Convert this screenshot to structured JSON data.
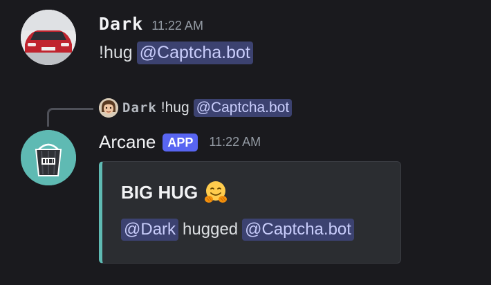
{
  "messages": [
    {
      "author": "Dark",
      "timestamp": "11:22 AM",
      "text": "!hug",
      "mention": "@Captcha.bot"
    },
    {
      "author": "Arcane",
      "badge": "APP",
      "timestamp": "11:22 AM",
      "reply": {
        "author": "Dark",
        "text": "!hug",
        "mention": "@Captcha.bot"
      },
      "embed": {
        "title": "BIG HUG",
        "title_emoji": "hugging-face-emoji",
        "description": {
          "mention_from": "@Dark",
          "verb": "hugged",
          "mention_to": "@Captcha.bot"
        },
        "accent_color": "#5fbab3"
      }
    }
  ],
  "colors": {
    "background": "#1a1a1e",
    "mention_bg": "#3c4270",
    "mention_text": "#c9cdfb",
    "app_badge": "#5865f2",
    "embed_bg": "#2b2d31",
    "timestamp": "#949ba4"
  }
}
